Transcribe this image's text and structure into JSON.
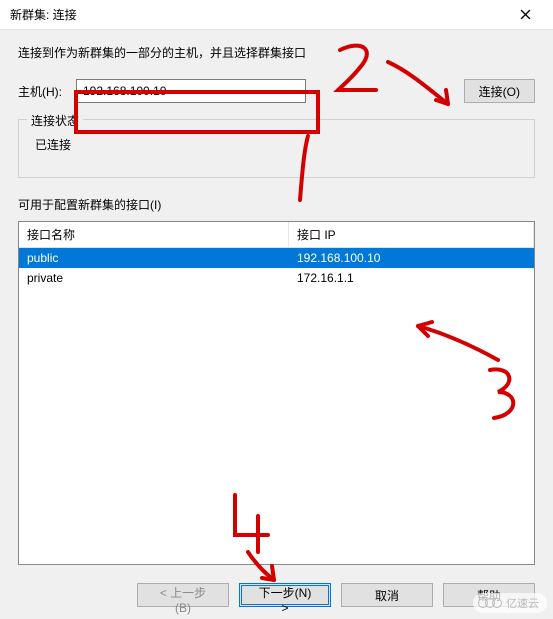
{
  "window": {
    "title": "新群集: 连接"
  },
  "instruction": "连接到作为新群集的一部分的主机，并且选择群集接口",
  "host": {
    "label": "主机(H):",
    "value": "192.168.100.10",
    "connect_button": "连接(O)"
  },
  "status_group": {
    "title": "连接状态",
    "text": "已连接"
  },
  "interfaces": {
    "label": "可用于配置新群集的接口(I)",
    "columns": {
      "name": "接口名称",
      "ip": "接口 IP"
    },
    "rows": [
      {
        "name": "public",
        "ip": "192.168.100.10",
        "selected": true
      },
      {
        "name": "private",
        "ip": "172.16.1.1",
        "selected": false
      }
    ]
  },
  "buttons": {
    "back": "< 上一步(B)",
    "next": "下一步(N) >",
    "cancel": "取消",
    "help": "帮助"
  },
  "annotations": {
    "marks": [
      "1",
      "2",
      "3",
      "4"
    ],
    "color": "#d40000"
  },
  "watermark": "亿速云"
}
